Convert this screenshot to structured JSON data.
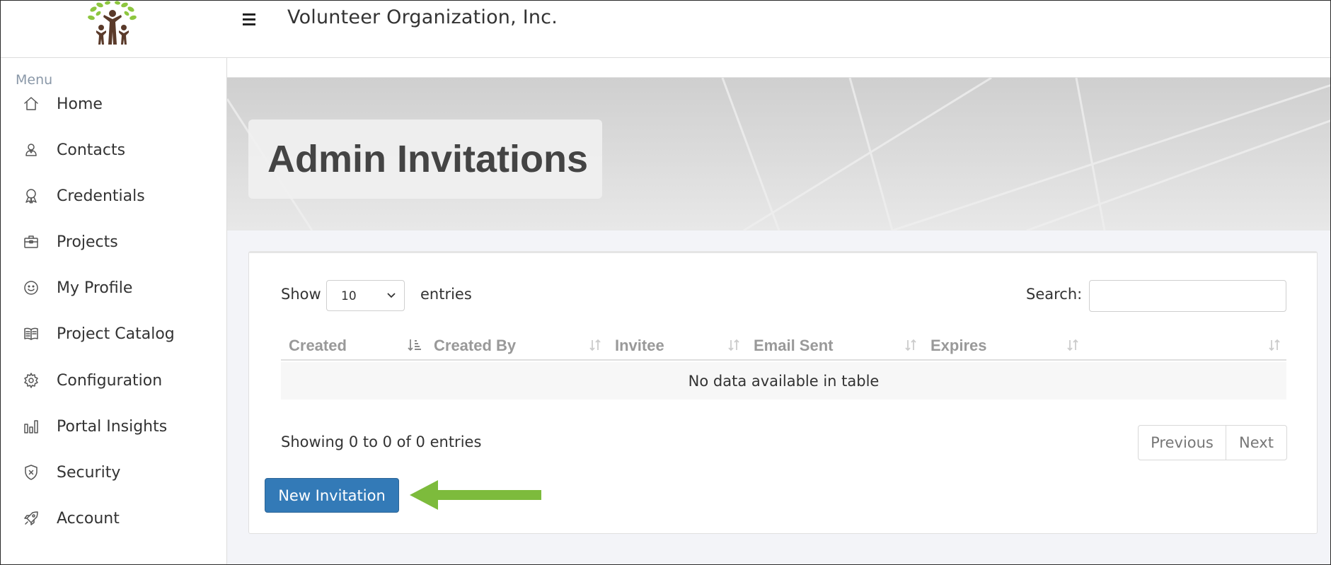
{
  "header": {
    "org_title": "Volunteer Organization, Inc.",
    "logo_icon": "people-tree-logo-icon",
    "menu_icon": "hamburger-icon"
  },
  "sidebar": {
    "menu_label": "Menu",
    "items": [
      {
        "label": "Home",
        "icon": "home-icon"
      },
      {
        "label": "Contacts",
        "icon": "contacts-icon"
      },
      {
        "label": "Credentials",
        "icon": "award-icon"
      },
      {
        "label": "Projects",
        "icon": "briefcase-icon"
      },
      {
        "label": "My Profile",
        "icon": "smiley-icon"
      },
      {
        "label": "Project Catalog",
        "icon": "book-icon"
      },
      {
        "label": "Configuration",
        "icon": "gear-icon"
      },
      {
        "label": "Portal Insights",
        "icon": "bar-chart-icon"
      },
      {
        "label": "Security",
        "icon": "shield-icon"
      },
      {
        "label": "Account",
        "icon": "rocket-icon"
      }
    ]
  },
  "page": {
    "title": "Admin Invitations"
  },
  "table": {
    "show_label": "Show",
    "page_length": "10",
    "entries_label": "entries",
    "search_label": "Search:",
    "search_value": "",
    "columns": [
      {
        "label": "Created",
        "sort": "sorted-ascending"
      },
      {
        "label": "Created By",
        "sort": "sortable"
      },
      {
        "label": "Invitee",
        "sort": "sortable"
      },
      {
        "label": "Email Sent",
        "sort": "sortable"
      },
      {
        "label": "Expires",
        "sort": "sortable"
      },
      {
        "label": "",
        "sort": "sortable"
      }
    ],
    "empty_message": "No data available in table",
    "info": "Showing 0 to 0 of 0 entries",
    "previous_label": "Previous",
    "next_label": "Next"
  },
  "actions": {
    "new_invitation_label": "New Invitation"
  },
  "colors": {
    "primary_button": "#337ab7",
    "annotation_arrow": "#7dbb3c",
    "header_text_muted": "#999999",
    "sidebar_menu_label": "#8a98a8"
  }
}
